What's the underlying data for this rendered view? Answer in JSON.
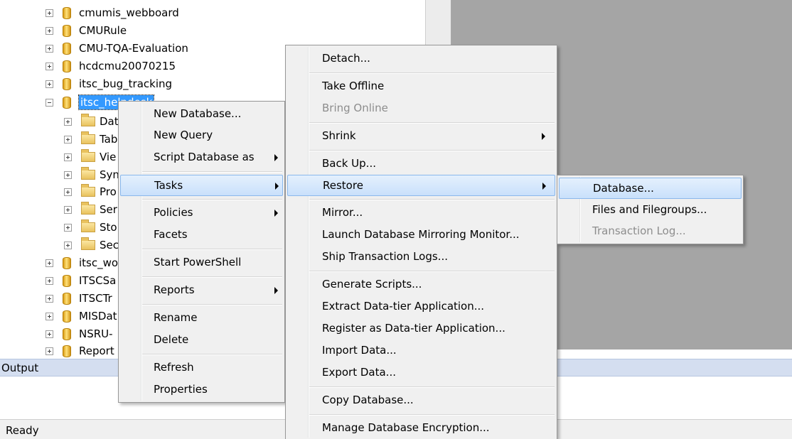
{
  "tree": {
    "items": [
      {
        "label": "cmumis_webboard",
        "kind": "db",
        "expander": "plus"
      },
      {
        "label": "CMURule",
        "kind": "db",
        "expander": "plus"
      },
      {
        "label": "CMU-TQA-Evaluation",
        "kind": "db",
        "expander": "plus"
      },
      {
        "label": "hcdcmu20070215",
        "kind": "db",
        "expander": "plus"
      },
      {
        "label": "itsc_bug_tracking",
        "kind": "db",
        "expander": "plus"
      },
      {
        "label": "itsc_helpdesk",
        "kind": "db",
        "expander": "minus",
        "selected": true
      },
      {
        "label": "Dat",
        "kind": "folder",
        "expander": "plus",
        "child": true
      },
      {
        "label": "Tab",
        "kind": "folder",
        "expander": "plus",
        "child": true
      },
      {
        "label": "Vie",
        "kind": "folder",
        "expander": "plus",
        "child": true
      },
      {
        "label": "Syn",
        "kind": "folder",
        "expander": "plus",
        "child": true
      },
      {
        "label": "Pro",
        "kind": "folder",
        "expander": "plus",
        "child": true
      },
      {
        "label": "Ser",
        "kind": "folder",
        "expander": "plus",
        "child": true
      },
      {
        "label": "Sto",
        "kind": "folder",
        "expander": "plus",
        "child": true
      },
      {
        "label": "Sec",
        "kind": "folder",
        "expander": "plus",
        "child": true
      },
      {
        "label": "itsc_wo",
        "kind": "db",
        "expander": "plus"
      },
      {
        "label": "ITSCSa",
        "kind": "db",
        "expander": "plus"
      },
      {
        "label": "ITSCTr",
        "kind": "db",
        "expander": "plus"
      },
      {
        "label": "MISDat",
        "kind": "db",
        "expander": "plus"
      },
      {
        "label": "NSRU-",
        "kind": "db",
        "expander": "plus"
      },
      {
        "label": "Report",
        "kind": "db",
        "expander": "plus"
      }
    ]
  },
  "context_menu": {
    "items": [
      {
        "label": "New Database..."
      },
      {
        "label": "New Query"
      },
      {
        "label": "Script Database as",
        "submenu": true
      },
      {
        "label": "Tasks",
        "submenu": true,
        "highlighted": true
      },
      {
        "label": "Policies",
        "submenu": true
      },
      {
        "label": "Facets"
      },
      {
        "label": "Start PowerShell"
      },
      {
        "label": "Reports",
        "submenu": true
      },
      {
        "label": "Rename"
      },
      {
        "label": "Delete"
      },
      {
        "label": "Refresh"
      },
      {
        "label": "Properties"
      }
    ]
  },
  "tasks_menu": {
    "items": [
      {
        "label": "Detach..."
      },
      {
        "label": "Take Offline"
      },
      {
        "label": "Bring Online",
        "disabled": true
      },
      {
        "label": "Shrink",
        "submenu": true
      },
      {
        "label": "Back Up..."
      },
      {
        "label": "Restore",
        "submenu": true,
        "highlighted": true
      },
      {
        "label": "Mirror..."
      },
      {
        "label": "Launch Database Mirroring Monitor..."
      },
      {
        "label": "Ship Transaction Logs..."
      },
      {
        "label": "Generate Scripts..."
      },
      {
        "label": "Extract Data-tier Application..."
      },
      {
        "label": "Register as Data-tier Application..."
      },
      {
        "label": "Import Data..."
      },
      {
        "label": "Export Data..."
      },
      {
        "label": "Copy Database..."
      },
      {
        "label": "Manage Database Encryption..."
      }
    ]
  },
  "restore_menu": {
    "items": [
      {
        "label": "Database...",
        "highlighted": true
      },
      {
        "label": "Files and Filegroups..."
      },
      {
        "label": "Transaction Log...",
        "disabled": true
      }
    ]
  },
  "output_pane": {
    "title": "Output"
  },
  "status_bar": {
    "text": "Ready"
  },
  "colors": {
    "selection": "#3399ff",
    "menu_bg": "#f0f0f0",
    "menu_highlight": "#c9e0fb",
    "gray_pane": "#a5a5a5",
    "output_bar": "#d4def0"
  }
}
